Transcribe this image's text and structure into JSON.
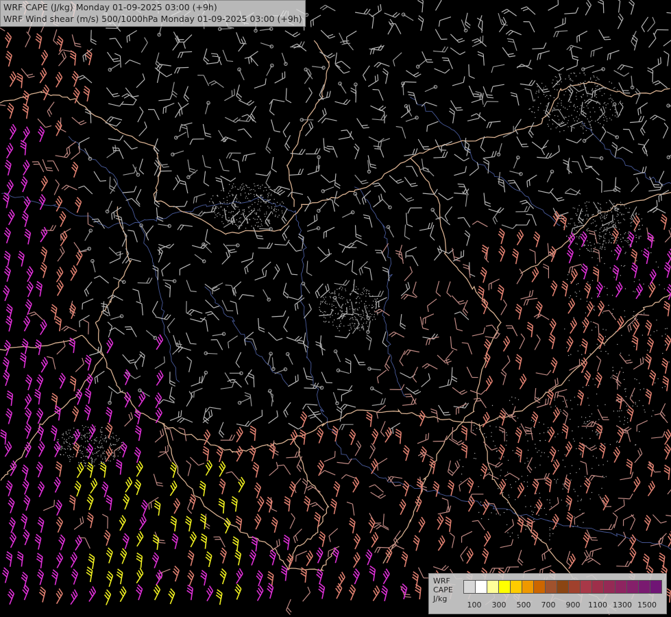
{
  "title_lines": [
    "WRF CAPE (J/kg) Monday 01-09-2025 03:00 (+9h)",
    "WRF Wind shear (m/s) 500/1000hPa Monday 01-09-2025 03:00 (+9h)"
  ],
  "legend": {
    "labels": [
      "WRF",
      "CAPE",
      "J/kg"
    ],
    "ticks": [
      "100",
      "300",
      "500",
      "700",
      "900",
      "1100",
      "1300",
      "1500"
    ],
    "colors": [
      "#d8d8d8",
      "#ffffff",
      "#ffff99",
      "#ffff00",
      "#ffcc00",
      "#ee9900",
      "#cc6600",
      "#a0522d",
      "#8b4513",
      "#a0412d",
      "#a83848",
      "#9e2f4a",
      "#952a55",
      "#8e2460",
      "#85206a",
      "#7a1a70",
      "#701575"
    ]
  },
  "barb_colors": {
    "calm": "#9a9a9a",
    "light": "#b8b8b8",
    "moderate": "#c08a84",
    "strong": "#e08070",
    "very_strong": "#e030d8",
    "extreme": "#f0f020"
  },
  "map_colors": {
    "border": "#d8b090",
    "river": "#5a70c0",
    "background": "#000000"
  }
}
